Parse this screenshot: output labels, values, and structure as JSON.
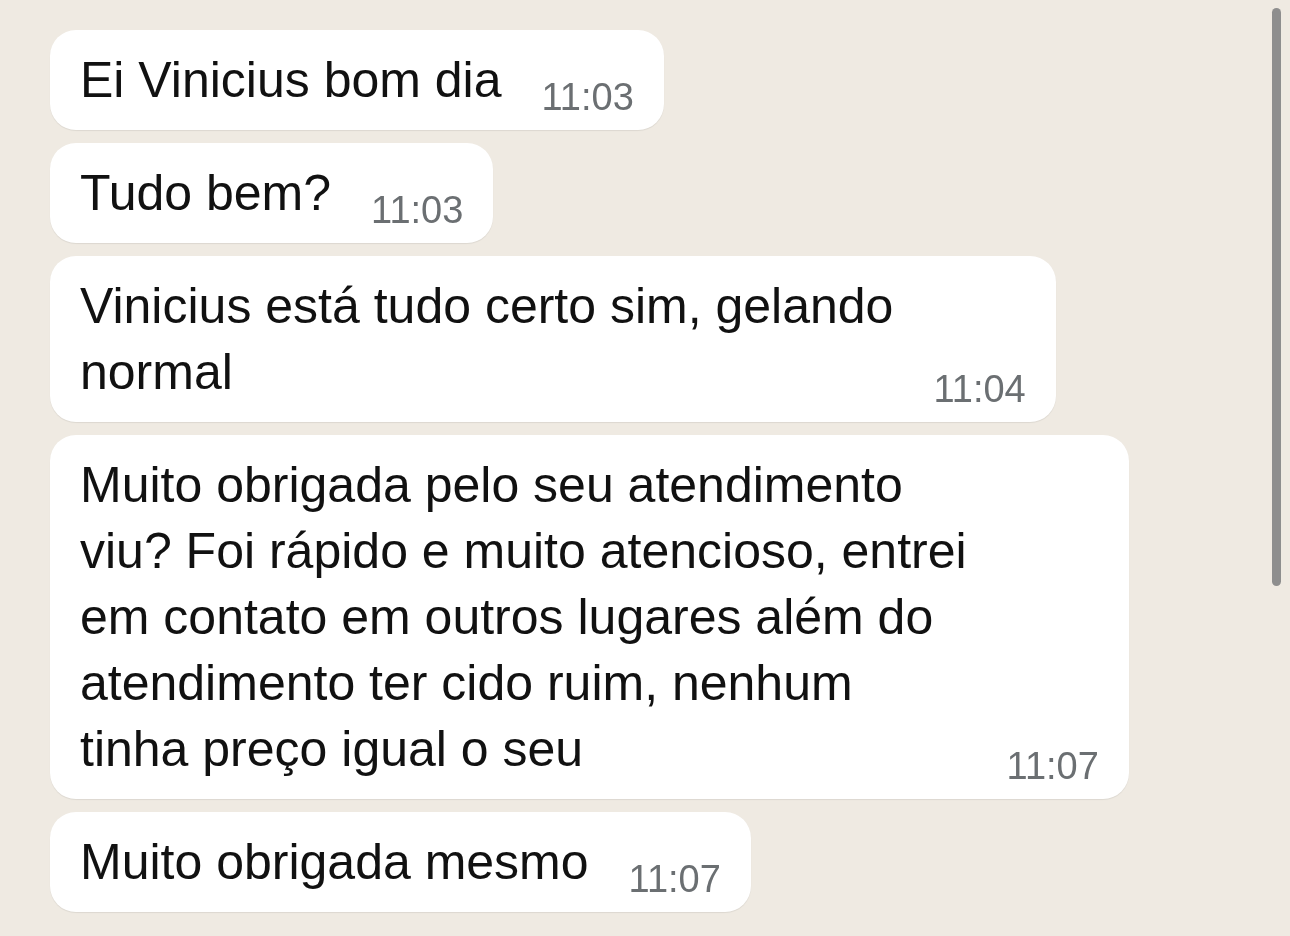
{
  "messages": [
    {
      "lines": [
        "Ei Vinicius bom dia"
      ],
      "time": "11:03"
    },
    {
      "lines": [
        "Tudo bem?"
      ],
      "time": "11:03"
    },
    {
      "lines": [
        "Vinicius está tudo certo sim, gelando",
        "normal"
      ],
      "time": "11:04"
    },
    {
      "lines": [
        "Muito obrigada pelo seu atendimento",
        "viu? Foi rápido e muito atencioso, entrei",
        "em contato em outros lugares além do",
        "atendimento ter cido ruim, nenhum",
        "tinha preço igual o seu"
      ],
      "time": "11:07"
    },
    {
      "lines": [
        "Muito obrigada mesmo"
      ],
      "time": "11:07"
    }
  ]
}
